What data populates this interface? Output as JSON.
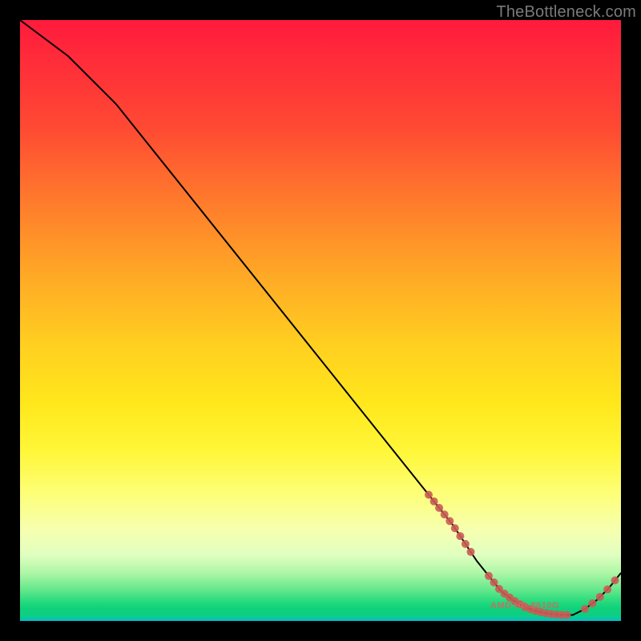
{
  "watermark": "TheBottleneck.com",
  "curve_label": "AMD HD 8610G",
  "colors": {
    "curve_stroke": "#000000",
    "marker_fill": "#cb5b55",
    "marker_stroke": "#cb5b55"
  },
  "chart_data": {
    "type": "line",
    "title": "",
    "xlabel": "",
    "ylabel": "",
    "xlim": [
      0,
      100
    ],
    "ylim": [
      0,
      100
    ],
    "x": [
      0,
      4,
      8,
      12,
      16,
      20,
      24,
      28,
      32,
      36,
      40,
      44,
      48,
      52,
      56,
      60,
      64,
      68,
      72,
      74,
      76,
      78,
      80,
      82,
      84,
      86,
      88,
      90,
      92,
      94,
      96,
      98,
      100
    ],
    "y": [
      100,
      97,
      94,
      90,
      86,
      81,
      76,
      71,
      66,
      61,
      56,
      51,
      46,
      41,
      36,
      31,
      26,
      21,
      16,
      13,
      10,
      7.5,
      5,
      3.5,
      2.3,
      1.6,
      1.2,
      1.0,
      1.0,
      2.0,
      3.5,
      5.5,
      8
    ],
    "marker_clusters": [
      {
        "x_range": [
          68,
          75
        ],
        "count": 9
      },
      {
        "x_range": [
          78,
          91
        ],
        "count": 16
      },
      {
        "x_range": [
          94,
          99
        ],
        "count": 5
      }
    ]
  }
}
